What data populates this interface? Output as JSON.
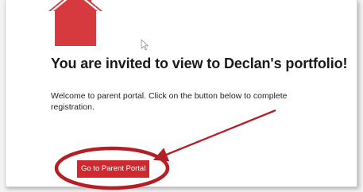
{
  "invitation": {
    "heading": "You are invited to view to Declan's portfolio!",
    "message": "Welcome to parent portal. Click on the button below to complete registration.",
    "button_label": "Go to Parent Portal"
  },
  "icons": {
    "logo": "house-icon",
    "cursor": "mouse-pointer-icon"
  },
  "colors": {
    "brand_red": "#d63a3e",
    "button_red": "#d0282f",
    "annotation_red": "#b41e24",
    "card_background": "#ffffff",
    "page_background": "#f3f3f3"
  },
  "annotation": {
    "type": "circle-and-arrow",
    "target": "portal-button"
  }
}
